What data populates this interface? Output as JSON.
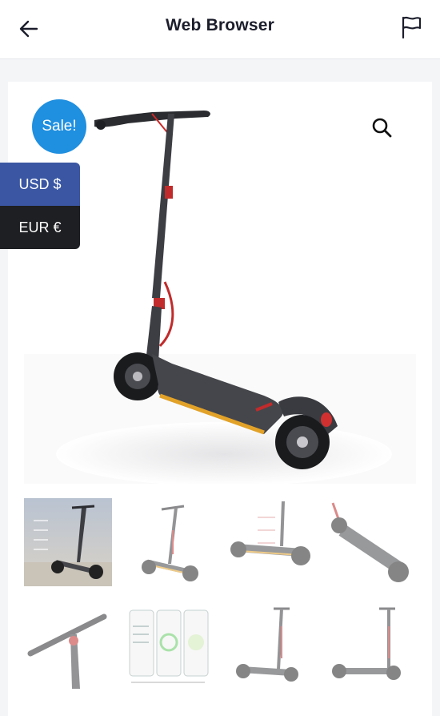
{
  "header": {
    "title": "Web Browser",
    "back_icon": "arrow-left-icon",
    "flag_icon": "flag-icon"
  },
  "product": {
    "sale_badge": "Sale!",
    "zoom_icon": "search-icon",
    "main_image": "electric-scooter"
  },
  "currency": {
    "options": [
      {
        "label": "USD $",
        "color": "#3b57a3"
      },
      {
        "label": "EUR €",
        "color": "#1e1f22"
      }
    ]
  },
  "thumbnails": [
    "scooter-with-speed-specs",
    "scooter-side-view",
    "scooter-detail-parts",
    "scooter-angled-top",
    "scooter-handlebar-closeup",
    "scooter-app-screens",
    "scooter-front-view",
    "scooter-rear-view"
  ]
}
